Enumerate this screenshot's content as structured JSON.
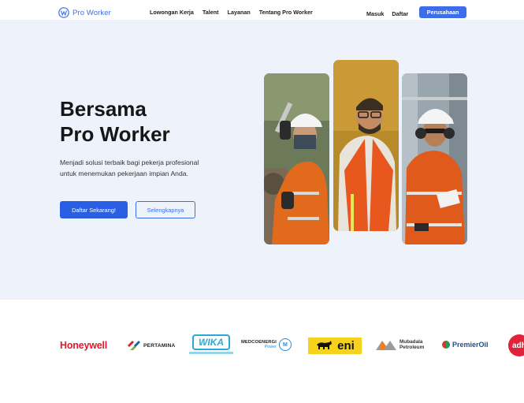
{
  "nav": {
    "logo_text": "Pro Worker",
    "links": [
      "Lowongan Kerja",
      "Talent",
      "Layanan",
      "Tentang Pro Worker"
    ],
    "login": "Masuk",
    "register": "Daftar",
    "company_button": "Perusahaan",
    "accent_color": "#3b6ee8"
  },
  "hero": {
    "title_line1": "Bersama",
    "title_line2": "Pro Worker",
    "description": "Menjadi solusi terbaik bagi pekerja profesional untuk menemukan pekerjaan impian Anda.",
    "primary_button": "Daftar Sekarang!",
    "secondary_button": "Selengkapnya",
    "background_color": "#eef2fb"
  },
  "partners": {
    "honeywell": "Honeywell",
    "pertamina": "PERTAMINA",
    "wika": "WIKA",
    "medco_main": "MEDCOENERGI",
    "medco_sub": "Power",
    "eni": "eni",
    "mubadala_line1": "Mubadala",
    "mubadala_line2": "Petroleum",
    "premier": "PremierOil",
    "adh": "adh"
  }
}
